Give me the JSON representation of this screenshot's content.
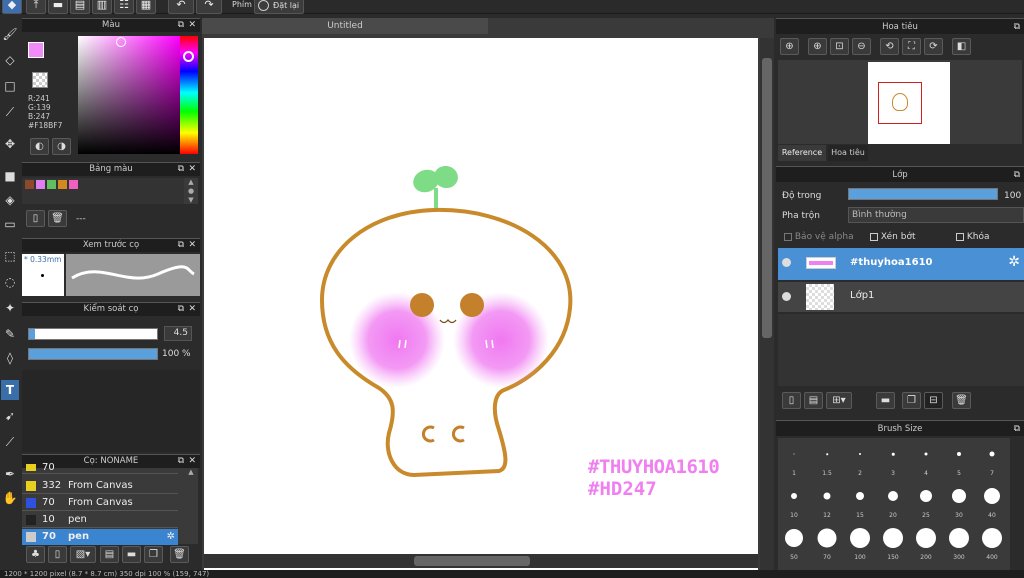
{
  "toolbar": {
    "phim_label": "Phím",
    "reset_label": "Đặt lại"
  },
  "canvas": {
    "tab_title": "Untitled"
  },
  "color_panel": {
    "title": "Màu",
    "r": "R:241",
    "g": "G:139",
    "b": "B:247",
    "hex": "#F18BF7",
    "fg_color": "#F18BF7"
  },
  "palette_panel": {
    "title": "Bảng màu",
    "swatches": [
      "#8b4a2b",
      "#e080f0",
      "#60c060",
      "#d08a20",
      "#f060c0"
    ],
    "empty": "---"
  },
  "brush_preview": {
    "title": "Xem trước cọ",
    "size": "* 0.33mm"
  },
  "brush_control": {
    "title": "Kiểm soát cọ",
    "size_value": "4.5",
    "opacity_value": "100 %",
    "size_fraction": 0.05,
    "opacity_fraction": 1.0
  },
  "brush_panel": {
    "title": "Cọ: NONAME",
    "items": [
      {
        "size": "70",
        "name": "",
        "color": "#e8d020",
        "selected": false
      },
      {
        "size": "332",
        "name": "From Canvas",
        "color": "#e8d020",
        "selected": false
      },
      {
        "size": "70",
        "name": "From Canvas",
        "color": "#3050e0",
        "selected": false
      },
      {
        "size": "10",
        "name": "pen",
        "color": "#222222",
        "selected": false
      },
      {
        "size": "70",
        "name": "pen",
        "color": "#cccccc",
        "selected": true
      }
    ]
  },
  "navigator": {
    "title": "Hoa tiêu",
    "tabs": [
      "Reference",
      "Hoa tiêu"
    ]
  },
  "layer_panel": {
    "title": "Lớp",
    "opacity_label": "Độ trong",
    "opacity_value": "100 %",
    "opacity_fraction": 1.0,
    "blend_label": "Pha trộn",
    "blend_value": "Bình thường",
    "protect_alpha": "Bảo vệ alpha",
    "clipping": "Xén bớt",
    "lock": "Khóa",
    "layers": [
      {
        "name": "#thuyhoa1610",
        "selected": true
      },
      {
        "name": "Lớp1",
        "selected": false
      }
    ]
  },
  "brush_size": {
    "title": "Brush Size",
    "sizes": [
      "1",
      "1.5",
      "2",
      "3",
      "4",
      "5",
      "7",
      "10",
      "12",
      "15",
      "20",
      "25",
      "30",
      "40",
      "50",
      "70",
      "100",
      "150",
      "200",
      "300",
      "400"
    ]
  },
  "artwork": {
    "watermark_line1": "#THUYHOA1610",
    "watermark_line2": "#HD247"
  },
  "status": {
    "text": "1200 * 1200 pixel   (8.7 * 8.7 cm)   350 dpi   100 %   (159, 747)"
  }
}
